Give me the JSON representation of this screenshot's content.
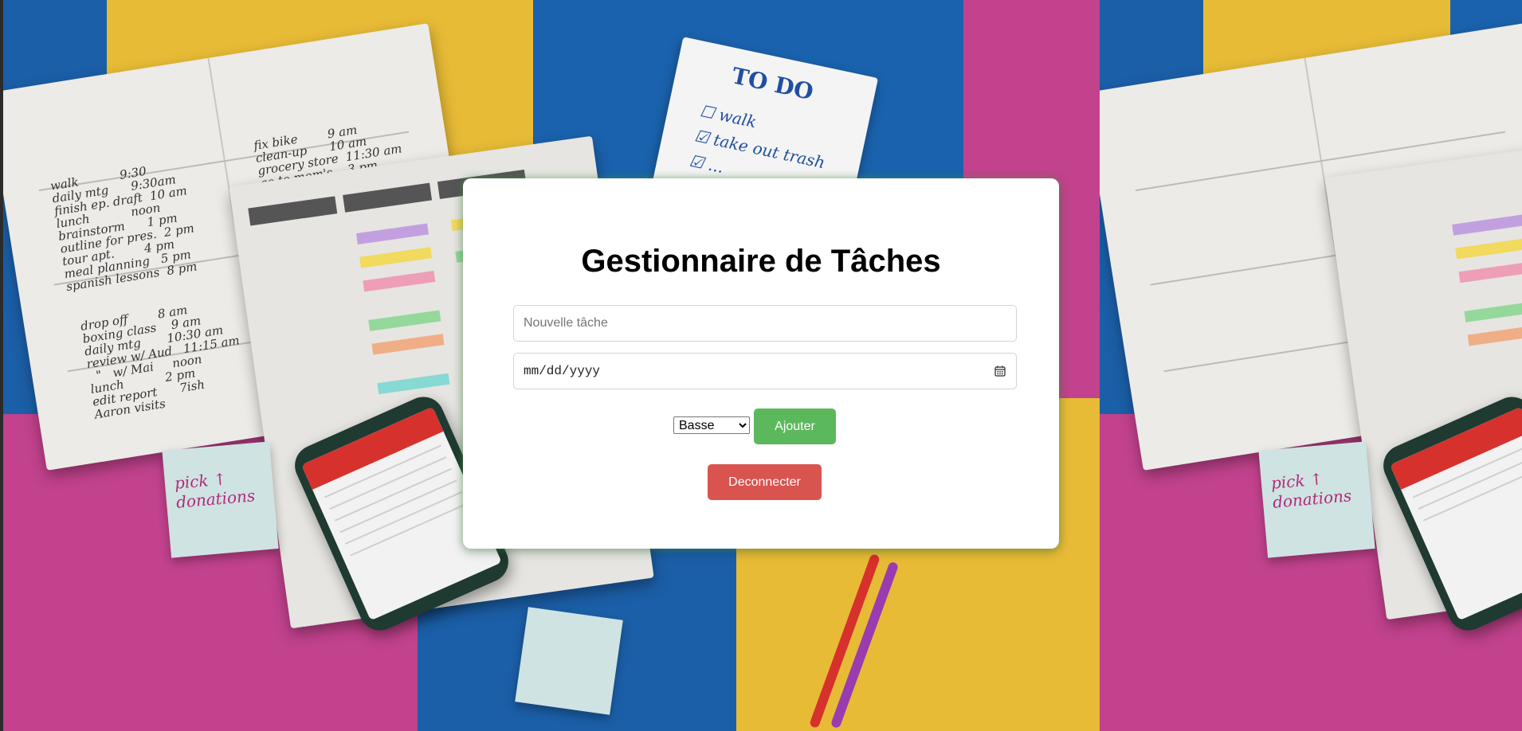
{
  "app": {
    "title": "Gestionnaire de Tâches"
  },
  "form": {
    "task_placeholder": "Nouvelle tâche",
    "task_value": "",
    "date_placeholder": "mm/dd/yyyy",
    "priority_selected": "Basse",
    "add_label": "Ajouter"
  },
  "session": {
    "logout_label": "Deconnecter"
  },
  "icons": {
    "date_picker": "calendar-icon",
    "select_arrow": "chevron-down-icon"
  },
  "colors": {
    "add_button": "#5cb85c",
    "logout_button": "#d9534f",
    "card_background": "#ffffff"
  }
}
